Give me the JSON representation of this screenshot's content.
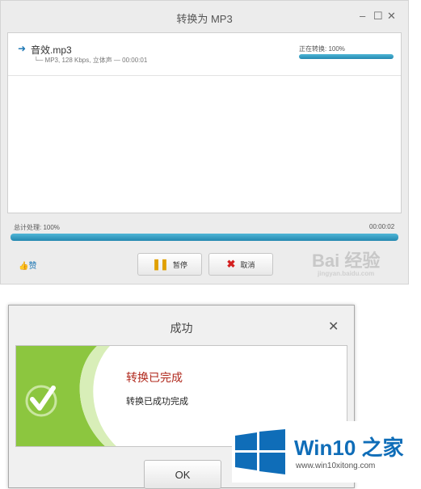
{
  "converter": {
    "title": "转换为 MP3",
    "controls": {
      "minimize": "–",
      "maximize": "☐",
      "close": "✕"
    },
    "file": {
      "name": "音效.mp3",
      "meta": "└─ MP3, 128 Kbps, 立体声 — 00:00:01",
      "status": "正在转换: 100%",
      "progress": 1.0
    },
    "total": {
      "label": "总计处理: 100%",
      "time": "00:00:02",
      "progress": 1.0
    },
    "like_label": "赞",
    "pause_label": "暂停",
    "cancel_label": "取消",
    "watermark": {
      "main": "Bai 经验",
      "sub": "jingyan.baidu.com"
    }
  },
  "success_dialog": {
    "title": "成功",
    "close": "✕",
    "heading": "转换已完成",
    "message": "转换已成功完成",
    "ok_label": "OK"
  },
  "site_watermark": {
    "name": "Win10 之家",
    "url": "www.win10xitong.com"
  },
  "colors": {
    "accent_blue": "#2488b0",
    "success_green": "#8cc63f",
    "heading_red": "#b0281c",
    "win10_blue": "#0f6db8"
  }
}
